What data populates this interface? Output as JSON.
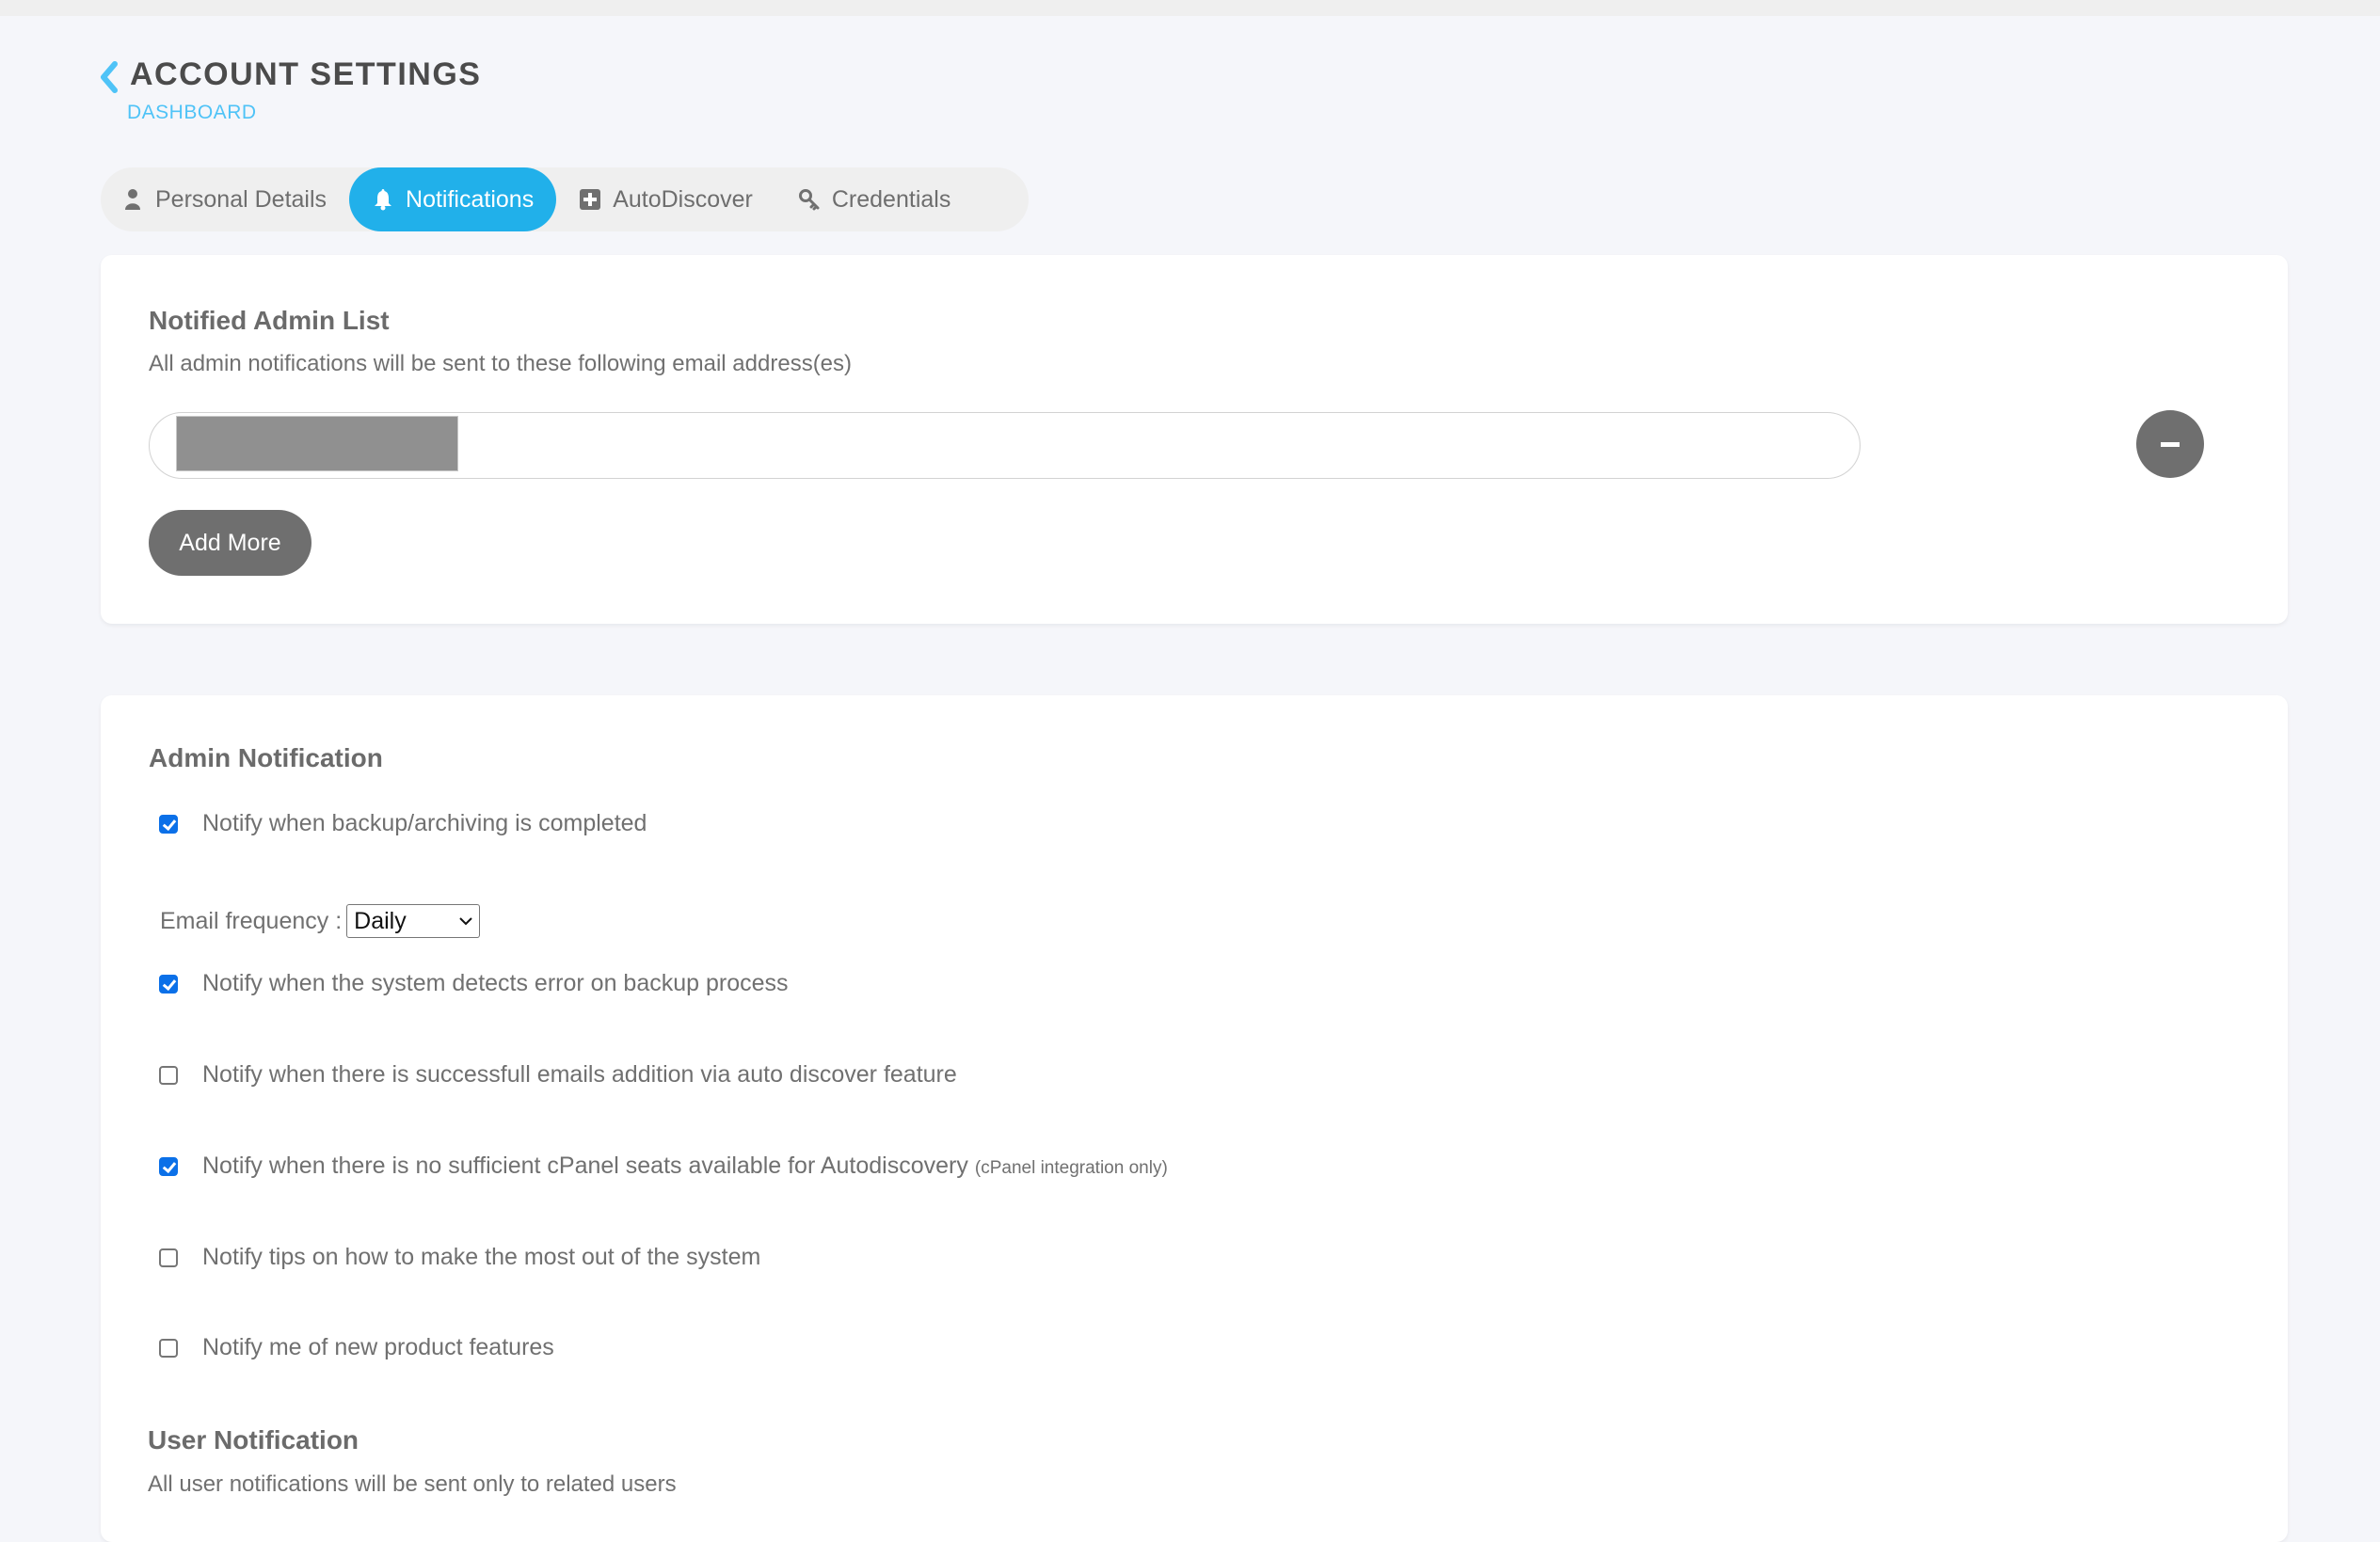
{
  "header": {
    "title": "ACCOUNT SETTINGS",
    "breadcrumb": "DASHBOARD",
    "back_icon": "chevron-left-icon"
  },
  "tabs": [
    {
      "label": "Personal Details",
      "icon": "user-icon",
      "active": false
    },
    {
      "label": "Notifications",
      "icon": "bell-icon",
      "active": true
    },
    {
      "label": "AutoDiscover",
      "icon": "plus-square-icon",
      "active": false
    },
    {
      "label": "Credentials",
      "icon": "key-icon",
      "active": false
    }
  ],
  "admin_list": {
    "title": "Notified Admin List",
    "description": "All admin notifications will be sent to these following email address(es)",
    "emails": [
      {
        "value": "[redacted]"
      }
    ],
    "remove_icon": "minus-circle-icon",
    "add_more_label": "Add More"
  },
  "admin_notification": {
    "title": "Admin Notification",
    "options": [
      {
        "label": "Notify when backup/archiving is completed",
        "checked": true,
        "note": ""
      },
      {
        "label": "Notify when the system detects error on backup process",
        "checked": true,
        "note": ""
      },
      {
        "label": "Notify when there is successfull emails addition via auto discover feature",
        "checked": false,
        "note": ""
      },
      {
        "label": "Notify when there is no sufficient cPanel seats available for Autodiscovery",
        "checked": true,
        "note": "(cPanel integration only)"
      },
      {
        "label": "Notify tips on how to make the most out of the system",
        "checked": false,
        "note": ""
      },
      {
        "label": "Notify me of new product features",
        "checked": false,
        "note": ""
      }
    ],
    "email_frequency": {
      "label": "Email frequency :",
      "selected": "Daily"
    }
  },
  "user_notification": {
    "title": "User Notification",
    "description": "All user notifications will be sent only to related users"
  },
  "colors": {
    "accent": "#21b0ea",
    "breadcrumb": "#4fc3f7",
    "checkbox": "#0b70e8",
    "button": "#6f6f6f",
    "page_bg": "#f5f6fa"
  }
}
